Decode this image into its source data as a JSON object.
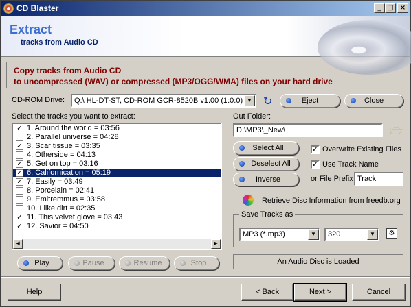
{
  "window": {
    "title": "CD Blaster"
  },
  "header": {
    "title": "Extract",
    "subtitle": "tracks from Audio CD"
  },
  "banner": {
    "line1": "Copy tracks from Audio CD",
    "line2": "to uncompressed (WAV) or compressed (MP3/OGG/WMA) files on your hard drive"
  },
  "drive": {
    "label": "CD-ROM Drive:",
    "value": "Q:\\ HL-DT-ST, CD-ROM GCR-8520B v1.00 (1:0:0)",
    "eject": "Eject",
    "close": "Close"
  },
  "tracks": {
    "label": "Select the tracks you want to extract:",
    "items": [
      {
        "text": "1. Around the world  = 03:56",
        "checked": true
      },
      {
        "text": "2. Parallel universe  = 04:28",
        "checked": false
      },
      {
        "text": "3. Scar tissue  = 03:35",
        "checked": true
      },
      {
        "text": "4. Otherside = 04:13",
        "checked": false
      },
      {
        "text": "5. Get on top = 03:16",
        "checked": true
      },
      {
        "text": "6. Californication = 05:19",
        "checked": true
      },
      {
        "text": "7. Easily = 03:49",
        "checked": true
      },
      {
        "text": "8. Porcelain = 02:41",
        "checked": false
      },
      {
        "text": "9. Emitremmus = 03:58",
        "checked": false
      },
      {
        "text": "10. I like dirt  = 02:35",
        "checked": false
      },
      {
        "text": "11. This velvet glove  = 03:43",
        "checked": true
      },
      {
        "text": "12. Savior = 04:50",
        "checked": true
      }
    ],
    "selected_index": 5
  },
  "playback": {
    "play": "Play",
    "pause": "Pause",
    "resume": "Resume",
    "stop": "Stop"
  },
  "output": {
    "label": "Out Folder:",
    "folder": "D:\\MP3\\_New\\",
    "select_all": "Select All",
    "deselect_all": "Deselect All",
    "inverse": "Inverse",
    "overwrite_label": "Overwrite Existing Files",
    "overwrite_checked": true,
    "use_track_name_label": "Use Track Name",
    "use_track_name_checked": true,
    "prefix_label": "or File Prefix",
    "prefix_value": "Track",
    "freedb": "Retrieve Disc Information from freedb.org"
  },
  "save": {
    "label": "Save Tracks as",
    "format": "MP3 (*.mp3)",
    "bitrate": "320"
  },
  "status": "An Audio Disc is Loaded",
  "footer": {
    "help": "Help",
    "back": "< Back",
    "next": "Next >",
    "cancel": "Cancel"
  },
  "icons": {
    "app": "cd-icon",
    "refresh": "refresh-icon",
    "folder": "folder-open-icon",
    "freedb": "color-wheel-icon",
    "settings": "settings-icon"
  },
  "colors": {
    "banner_text": "#800000",
    "header_title": "#3a6ed0",
    "selection": "#0a246a"
  }
}
